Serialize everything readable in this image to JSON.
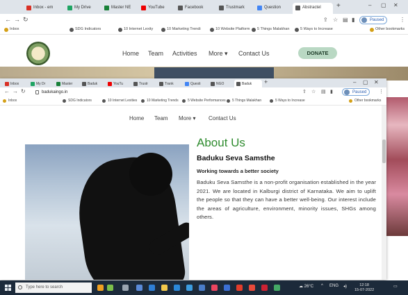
{
  "bg_browser": {
    "tabs": [
      "Inbox - em",
      "My Drive",
      "Master NE",
      "YouTube",
      "Facebook",
      "Trustmark",
      "Question",
      "Abstractel"
    ],
    "url": "",
    "bookmarks": [
      "Inbox",
      "SDG Indicators",
      "10 Internet Lexity",
      "10 Marketing Trendi",
      "10 Website Platform",
      "5 Things Malakhan",
      "5 Ways to Increase",
      "Other bookmarks"
    ],
    "profile": "Paused",
    "nav": {
      "home": "Home",
      "team": "Team",
      "activities": "Activities",
      "more": "More",
      "contact": "Contact Us",
      "donate": "DONATE"
    },
    "banner_text": ""
  },
  "fg_browser": {
    "tabs": [
      "Inbox",
      "My Dr",
      "Master",
      "Baduk",
      "YouTu",
      "Trustr",
      "Trank",
      "Questi",
      "NGO",
      "Baduk"
    ],
    "url": "badukaingo.in",
    "profile": "Paused",
    "bookmarks": [
      "Inbox",
      "SDG Indicators",
      "10 Internet Lexities",
      "10 Marketing Trends",
      "5 Website Performances",
      "5 Things Malakhan",
      "5 Ways to Increase",
      "Other bookmarks"
    ],
    "nav": {
      "home": "Home",
      "team": "Team",
      "more": "More",
      "contact": "Contact Us"
    }
  },
  "about": {
    "heading": "About Us",
    "org_name": "Baduku Seva Samsthe",
    "tagline": "Working towards a better society",
    "description": "Baduku Seva Samsthe is a non-profit organisation established in the year 2021. We are located in Kalburgi district of Karnataka. We aim to uplift the people so that they can have a better well-being. Our interest include the areas of agriculture, environment, minority issues, SHGs among others."
  },
  "taskbar": {
    "search_placeholder": "Type here to search",
    "weather": "26°C",
    "language": "ENG",
    "time": "12:18",
    "date": "15-07-2022"
  },
  "colors": {
    "accent_green": "#2e8b2e",
    "donate_bg": "#b9d8c3",
    "taskbar": "#1c2a3a"
  },
  "icons": [
    "back-icon",
    "forward-icon",
    "reload-icon",
    "lock-icon",
    "share-icon",
    "star-icon",
    "extensions-icon",
    "menu-icon",
    "windows-start-icon",
    "search-icon"
  ]
}
